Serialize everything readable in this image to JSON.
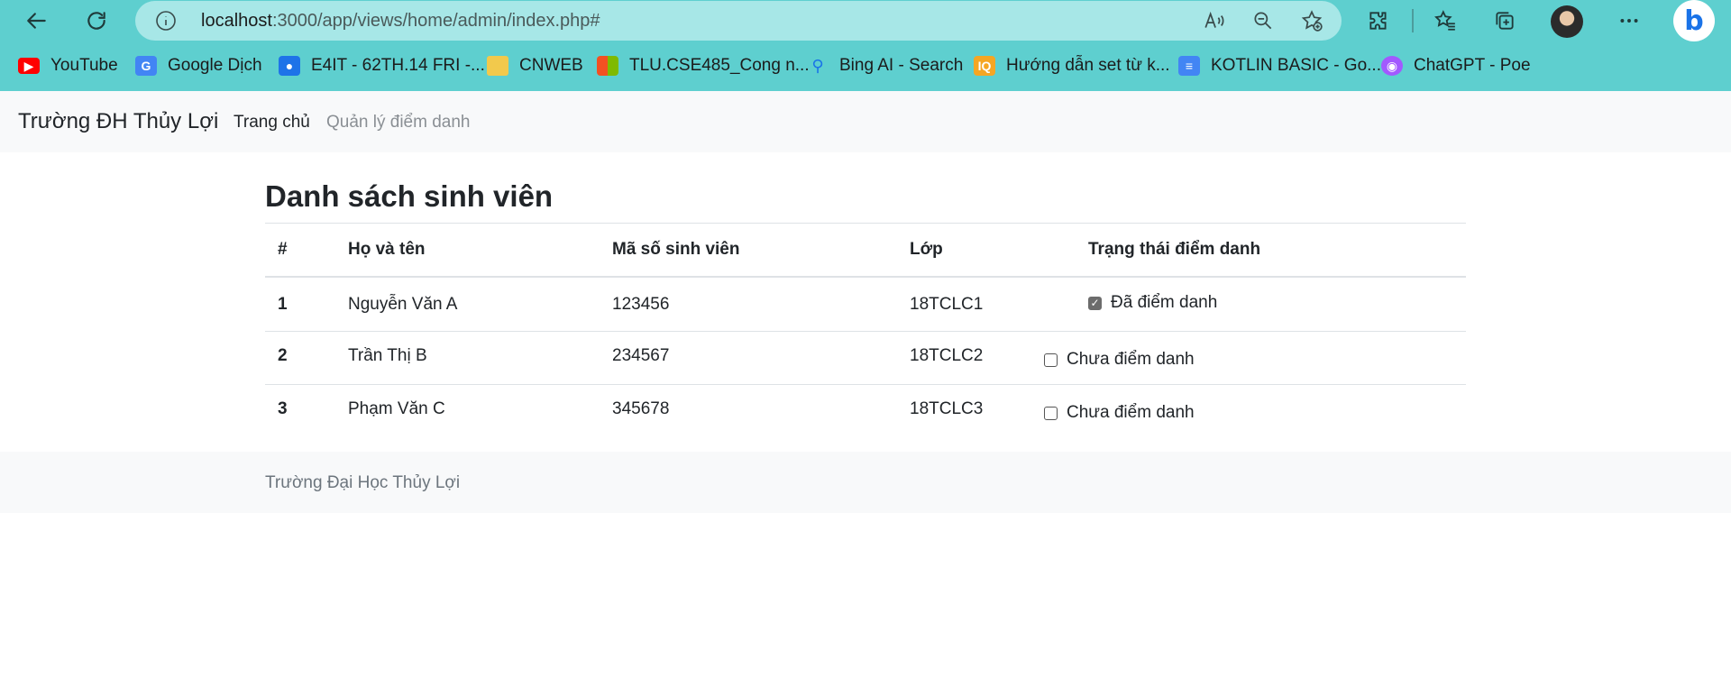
{
  "browser": {
    "url_host": "localhost",
    "url_rest": ":3000/app/views/home/admin/index.php#",
    "bookmarks": [
      {
        "label": "YouTube",
        "icon": "youtube-icon",
        "color": "#ff0000"
      },
      {
        "label": "Google Dịch",
        "icon": "google-translate-icon",
        "color": "#4285f4"
      },
      {
        "label": "E4IT - 62TH.14 FRI -...",
        "icon": "classroom-icon",
        "color": "#1e73e8"
      },
      {
        "label": "CNWEB",
        "icon": "folder-icon",
        "color": "#f2c94c"
      },
      {
        "label": "TLU.CSE485_Cong n...",
        "icon": "microsoft-icon",
        "color": "#f25022"
      },
      {
        "label": "Bing AI - Search",
        "icon": "search-icon",
        "color": "#1a73e8"
      },
      {
        "label": "Hướng dẫn set từ k...",
        "icon": "iq-icon",
        "color": "#f5a623"
      },
      {
        "label": "KOTLIN BASIC - Go...",
        "icon": "docs-icon",
        "color": "#4285f4"
      },
      {
        "label": "ChatGPT - Poe",
        "icon": "poe-icon",
        "color": "#a259ff"
      }
    ]
  },
  "navbar": {
    "brand": "Trường ĐH Thủy Lợi",
    "links": [
      "Trang chủ",
      "Quản lý điểm danh"
    ]
  },
  "page": {
    "title": "Danh sách sinh viên",
    "columns": [
      "#",
      "Họ và tên",
      "Mã số sinh viên",
      "Lớp",
      "Trạng thái điểm danh"
    ],
    "rows": [
      {
        "num": "1",
        "name": "Nguyễn Văn A",
        "id": "123456",
        "class": "18TCLC1",
        "status": "Đã điểm danh",
        "checked": true
      },
      {
        "num": "2",
        "name": "Trần Thị B",
        "id": "234567",
        "class": "18TCLC2",
        "status": "Chưa điểm danh",
        "checked": false
      },
      {
        "num": "3",
        "name": "Phạm Văn C",
        "id": "345678",
        "class": "18TCLC3",
        "status": "Chưa điểm danh",
        "checked": false
      }
    ]
  },
  "footer": {
    "text": "Trường Đại Học Thủy Lợi"
  }
}
